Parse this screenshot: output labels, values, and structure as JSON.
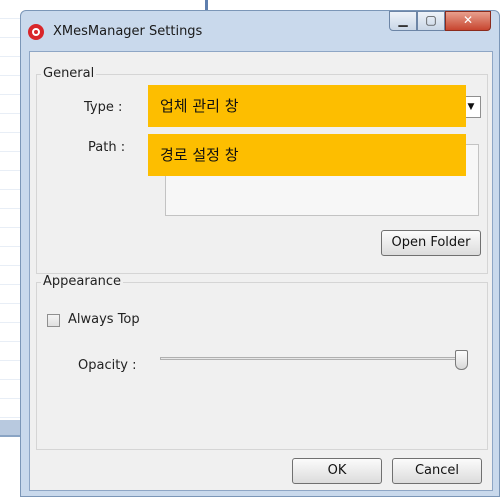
{
  "window": {
    "title": "XMesManager Settings"
  },
  "general": {
    "group_label": "General",
    "type_label": "Type :",
    "path_label": "Path :",
    "open_folder_label": "Open Folder"
  },
  "annotations": {
    "type_note": "업체 관리 창",
    "path_note": "경로 설정 창"
  },
  "appearance": {
    "group_label": "Appearance",
    "always_top_label": "Always Top",
    "always_top_checked": false,
    "opacity_label": "Opacity :",
    "opacity_level": 1.0
  },
  "buttons": {
    "ok": "OK",
    "cancel": "Cancel"
  },
  "colors": {
    "highlight": "#fdbe00",
    "frame": "#c9d9ec"
  }
}
